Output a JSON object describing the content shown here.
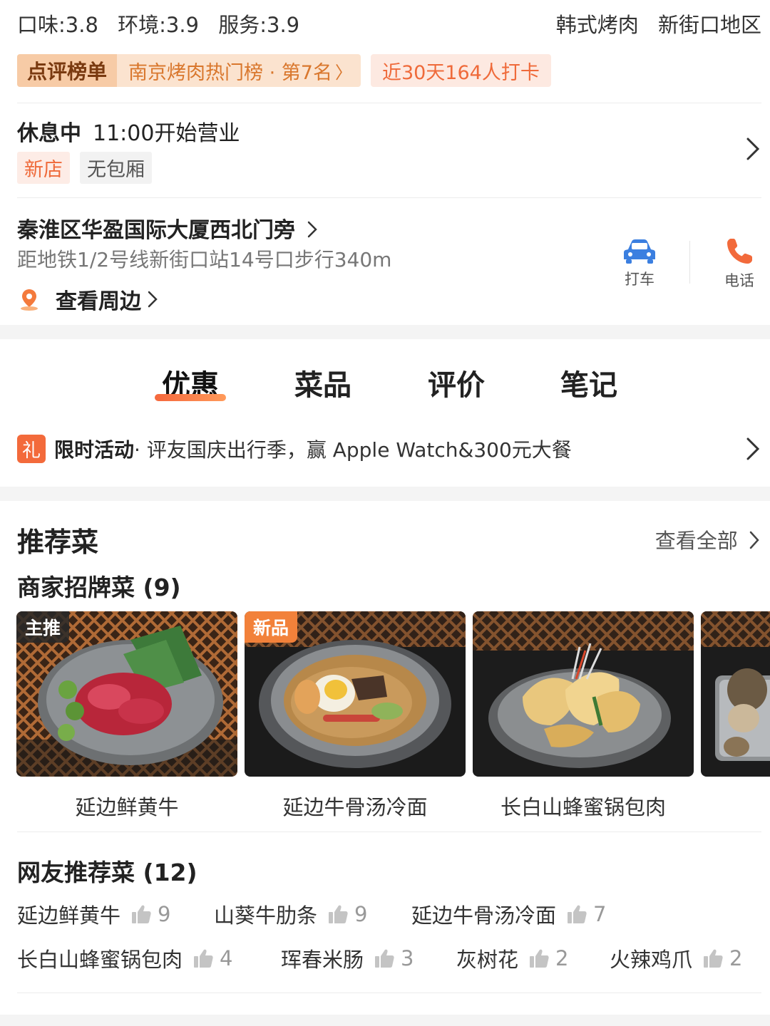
{
  "scores": {
    "taste": "口味:3.8",
    "environment": "环境:3.9",
    "service": "服务:3.9"
  },
  "cuisine": {
    "type": "韩式烤肉",
    "area": "新街口地区"
  },
  "ranking": {
    "label": "点评榜单",
    "text": "南京烤肉热门榜 · 第7名",
    "checkin": "近30天164人打卡"
  },
  "status": {
    "state": "休息中",
    "hours": "11:00开始营业",
    "tags": [
      "新店",
      "无包厢"
    ]
  },
  "address": {
    "line": "秦淮区华盈国际大厦西北门旁",
    "metro": "距地铁1/2号线新街口站14号口步行340m",
    "nearby": "查看周边"
  },
  "actions": {
    "taxi": "打车",
    "phone": "电话"
  },
  "tabs": [
    "优惠",
    "菜品",
    "评价",
    "笔记"
  ],
  "promo": {
    "icon_text": "礼",
    "title": "限时活动",
    "text": " · 评友国庆出行季，赢 Apple Watch&300元大餐"
  },
  "recommend": {
    "title": "推荐菜",
    "view_all": "查看全部",
    "signature_title": "商家招牌菜 (9)",
    "dishes": [
      {
        "name": "延边鲜黄牛",
        "badge": "主推"
      },
      {
        "name": "延边牛骨汤冷面",
        "badge": "新品"
      },
      {
        "name": "长白山蜂蜜锅包肉",
        "badge": ""
      }
    ],
    "user_title": "网友推荐菜 (12)",
    "user_dishes": [
      {
        "name": "延边鲜黄牛",
        "count": "9"
      },
      {
        "name": "山葵牛肋条",
        "count": "9"
      },
      {
        "name": "延边牛骨汤冷面",
        "count": "7"
      },
      {
        "name": "长白山蜂蜜锅包肉",
        "count": "4"
      },
      {
        "name": "珲春米肠",
        "count": "3"
      },
      {
        "name": "灰树花",
        "count": "2"
      },
      {
        "name": "火辣鸡爪",
        "count": "2"
      }
    ]
  },
  "colors": {
    "accent": "#f36a3b",
    "badge_bg": "#fbe3cf",
    "muted": "#999999"
  }
}
